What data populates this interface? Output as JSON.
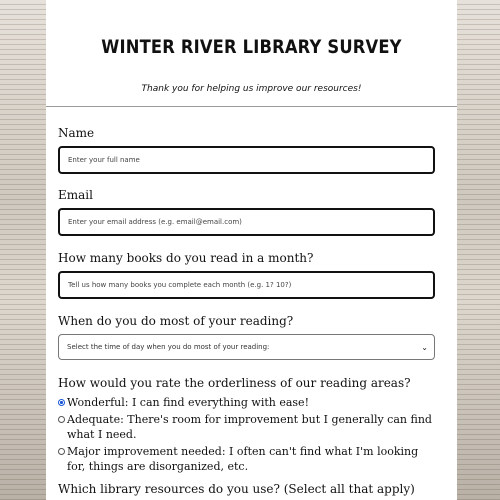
{
  "survey": {
    "title": "WINTER RIVER LIBRARY SURVEY",
    "subtitle": "Thank you for helping us improve our resources!",
    "name": {
      "label": "Name",
      "placeholder": "Enter your full name"
    },
    "email": {
      "label": "Email",
      "placeholder": "Enter your email address (e.g. email@email.com)"
    },
    "books": {
      "label": "How many books do you read in a month?",
      "placeholder": "Tell us how many books you complete each month (e.g. 1? 10?)"
    },
    "reading_time": {
      "label": "When do you do most of your reading?",
      "selected": "Select the time of day when you do most of your reading:"
    },
    "orderliness": {
      "label": "How would you rate the orderliness of our reading areas?",
      "options": [
        {
          "text": "Wonderful: I can find everything with ease!",
          "checked": true
        },
        {
          "text": "Adequate: There's room for improvement but I generally can find what I need.",
          "checked": false
        },
        {
          "text": "Major improvement needed: I often can't find what I'm looking for, things are disorganized, etc.",
          "checked": false
        }
      ]
    },
    "resources": {
      "label": "Which library resources do you use? (Select all that apply)"
    }
  },
  "colors": {
    "accent": "#1a57d6",
    "border": "#111111"
  },
  "icons": {
    "select_arrow": "chevron-down-icon"
  }
}
